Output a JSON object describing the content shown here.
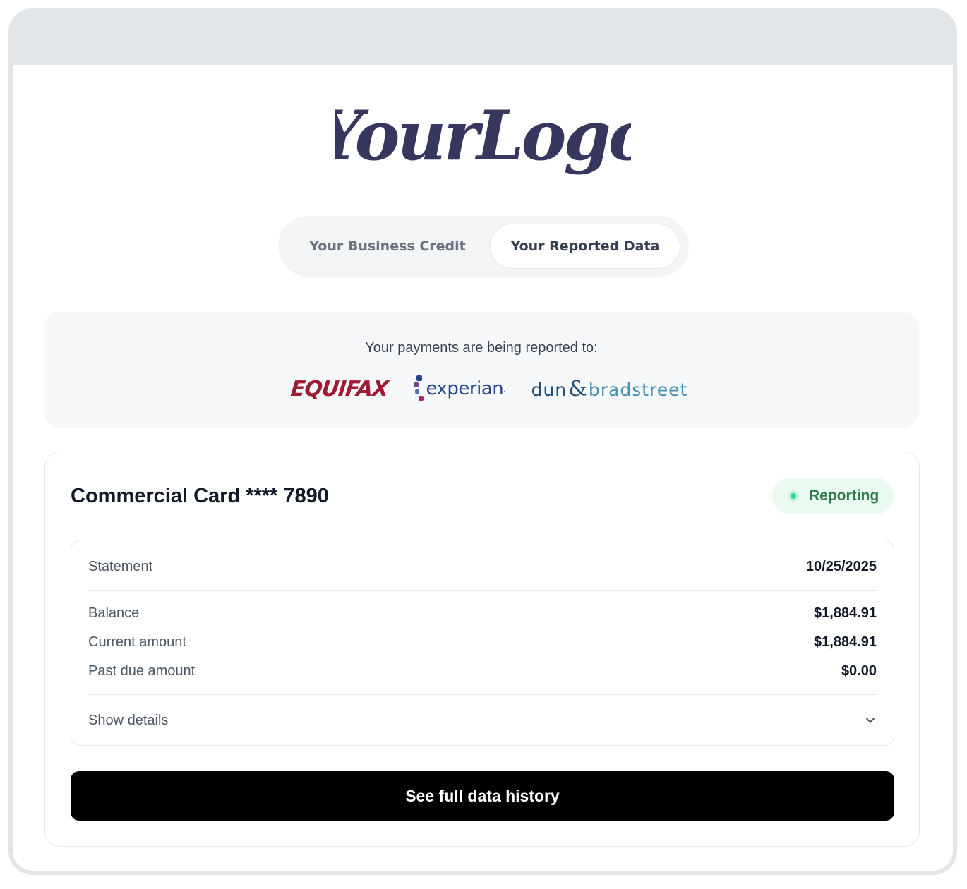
{
  "logo": {
    "text": "YourLogo",
    "color": "#36365f"
  },
  "tabs": [
    {
      "label": "Your Business Credit",
      "active": false
    },
    {
      "label": "Your Reported Data",
      "active": true
    }
  ],
  "reporting": {
    "text": "Your payments are being reported to:",
    "bureaus": {
      "equifax": "EQUIFAX",
      "experian": "experian",
      "experian_mark": ".",
      "dnb_part1": "dun",
      "dnb_amp": "&",
      "dnb_part2": "bradstreet"
    }
  },
  "card": {
    "title": "Commercial Card **** 7890",
    "status": "Reporting",
    "status_color": "#2f7a4c",
    "statement": {
      "label": "Statement",
      "value": "10/25/2025"
    },
    "rows": [
      {
        "label": "Balance",
        "value": "$1,884.91"
      },
      {
        "label": "Current amount",
        "value": "$1,884.91"
      },
      {
        "label": "Past due amount",
        "value": "$0.00"
      }
    ],
    "show_details": "Show details",
    "cta": "See full data history"
  },
  "icons": {
    "status": "status-dot-icon",
    "expand": "chevron-down-icon"
  }
}
